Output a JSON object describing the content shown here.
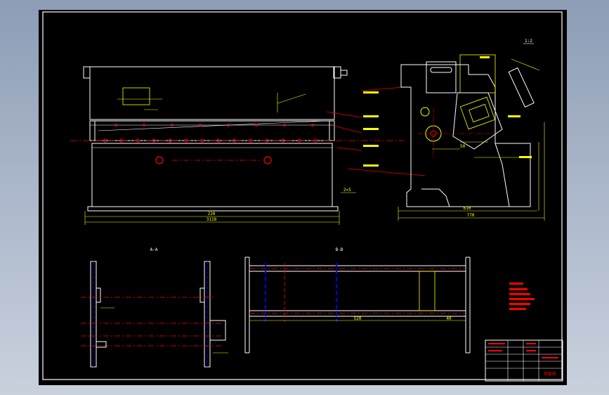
{
  "drawing": {
    "colors": {
      "background": "#000000",
      "outline": "#ffffff",
      "dimension": "#ffff00",
      "centerline": "#ff0000",
      "leader": "#ff0000",
      "hidden": "#0000ff",
      "note": "#ff0000"
    },
    "front_view": {
      "dim_width_inner": "220",
      "dim_width_outer": "3128",
      "callout_right": "2×5"
    },
    "side_view": {
      "scale_label": "1:2",
      "dim_base_a": "610",
      "dim_base_b": "770",
      "dim_mid": "50"
    },
    "detail_views": {
      "left_title": "A-A",
      "center_title": "B-B",
      "center_dim_bottom": "520",
      "center_dim_right": "40"
    },
    "title_block": {
      "label": "剪板机"
    }
  }
}
